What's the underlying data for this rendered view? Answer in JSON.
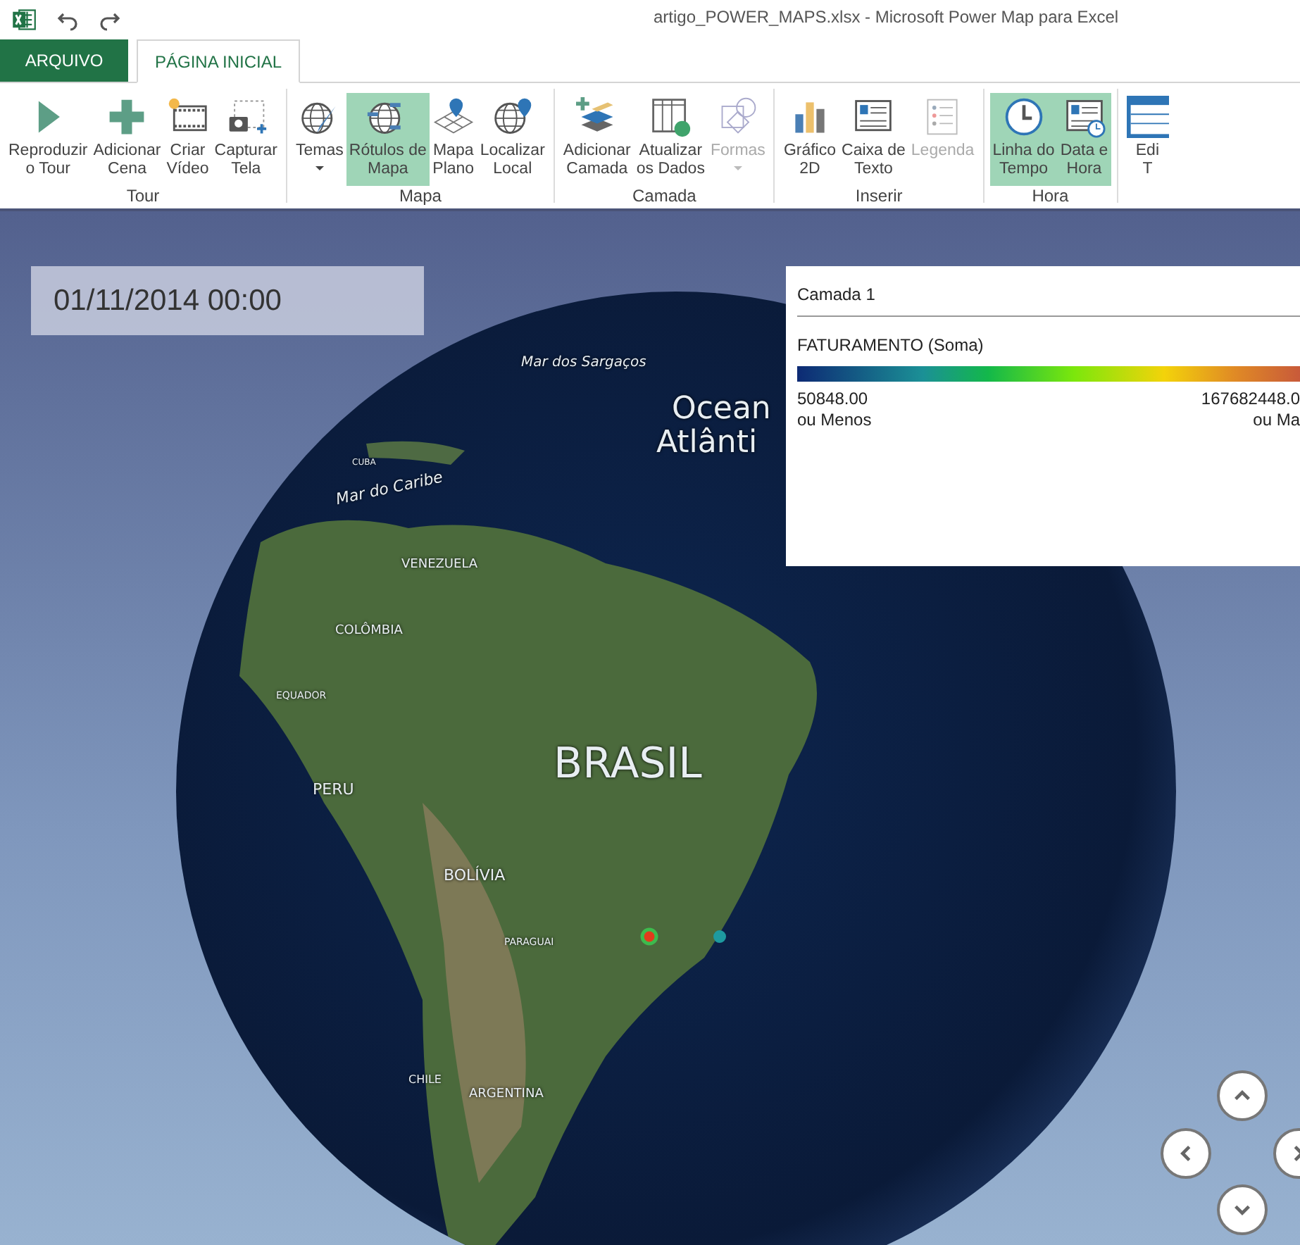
{
  "window": {
    "title": "artigo_POWER_MAPS.xlsx - Microsoft Power Map para Excel"
  },
  "tabs": [
    {
      "label": "ARQUIVO",
      "kind": "file",
      "selected": false
    },
    {
      "label": "PÁGINA INICIAL",
      "kind": "tab",
      "selected": true
    }
  ],
  "ribbon": {
    "groups": [
      {
        "label": "Tour",
        "buttons": [
          {
            "lines": [
              "Reproduzir",
              "o Tour"
            ],
            "selected": false,
            "disabled": false,
            "dropdown": false
          },
          {
            "lines": [
              "Adicionar",
              "Cena"
            ],
            "selected": false,
            "disabled": false,
            "dropdown": false
          },
          {
            "lines": [
              "Criar",
              "Vídeo"
            ],
            "selected": false,
            "disabled": false,
            "dropdown": false
          },
          {
            "lines": [
              "Capturar",
              "Tela"
            ],
            "selected": false,
            "disabled": false,
            "dropdown": false
          }
        ]
      },
      {
        "label": "Mapa",
        "buttons": [
          {
            "lines": [
              "Temas"
            ],
            "selected": false,
            "disabled": false,
            "dropdown": true
          },
          {
            "lines": [
              "Rótulos de",
              "Mapa"
            ],
            "selected": true,
            "disabled": false,
            "dropdown": false
          },
          {
            "lines": [
              "Mapa",
              "Plano"
            ],
            "selected": false,
            "disabled": false,
            "dropdown": false
          },
          {
            "lines": [
              "Localizar",
              "Local"
            ],
            "selected": false,
            "disabled": false,
            "dropdown": false
          }
        ]
      },
      {
        "label": "Camada",
        "buttons": [
          {
            "lines": [
              "Adicionar",
              "Camada"
            ],
            "selected": false,
            "disabled": false,
            "dropdown": false
          },
          {
            "lines": [
              "Atualizar",
              "os Dados"
            ],
            "selected": false,
            "disabled": false,
            "dropdown": false
          },
          {
            "lines": [
              "Formas"
            ],
            "selected": false,
            "disabled": true,
            "dropdown": true
          }
        ]
      },
      {
        "label": "Inserir",
        "buttons": [
          {
            "lines": [
              "Gráfico",
              "2D"
            ],
            "selected": false,
            "disabled": false,
            "dropdown": false
          },
          {
            "lines": [
              "Caixa de",
              "Texto"
            ],
            "selected": false,
            "disabled": false,
            "dropdown": false
          },
          {
            "lines": [
              "Legenda"
            ],
            "selected": false,
            "disabled": true,
            "dropdown": false
          }
        ]
      },
      {
        "label": "Hora",
        "buttons": [
          {
            "lines": [
              "Linha do",
              "Tempo"
            ],
            "selected": true,
            "disabled": false,
            "dropdown": false
          },
          {
            "lines": [
              "Data e",
              "Hora"
            ],
            "selected": true,
            "disabled": false,
            "dropdown": false
          }
        ]
      },
      {
        "buttons": [
          {
            "lines": [
              "Edi",
              "T"
            ],
            "selected": false,
            "disabled": false,
            "dropdown": false
          }
        ]
      }
    ]
  },
  "map": {
    "date": "01/11/2014 00:00",
    "labels": [
      "Mar dos Sargaços",
      "Ocean",
      "Atlânti",
      "CUBA",
      "Mar do Caribe",
      "VENEZUELA",
      "COLÔMBIA",
      "EQUADOR",
      "BRASIL",
      "PERU",
      "BOLÍVIA",
      "PARAGUAI",
      "CHILE",
      "ARGENTINA"
    ],
    "legend": {
      "layer": "Camada 1",
      "field": "FATURAMENTO (Soma)",
      "min": "50848.00",
      "min_note": "ou Menos",
      "max": "167682448.0",
      "max_note": "ou Ma"
    }
  }
}
